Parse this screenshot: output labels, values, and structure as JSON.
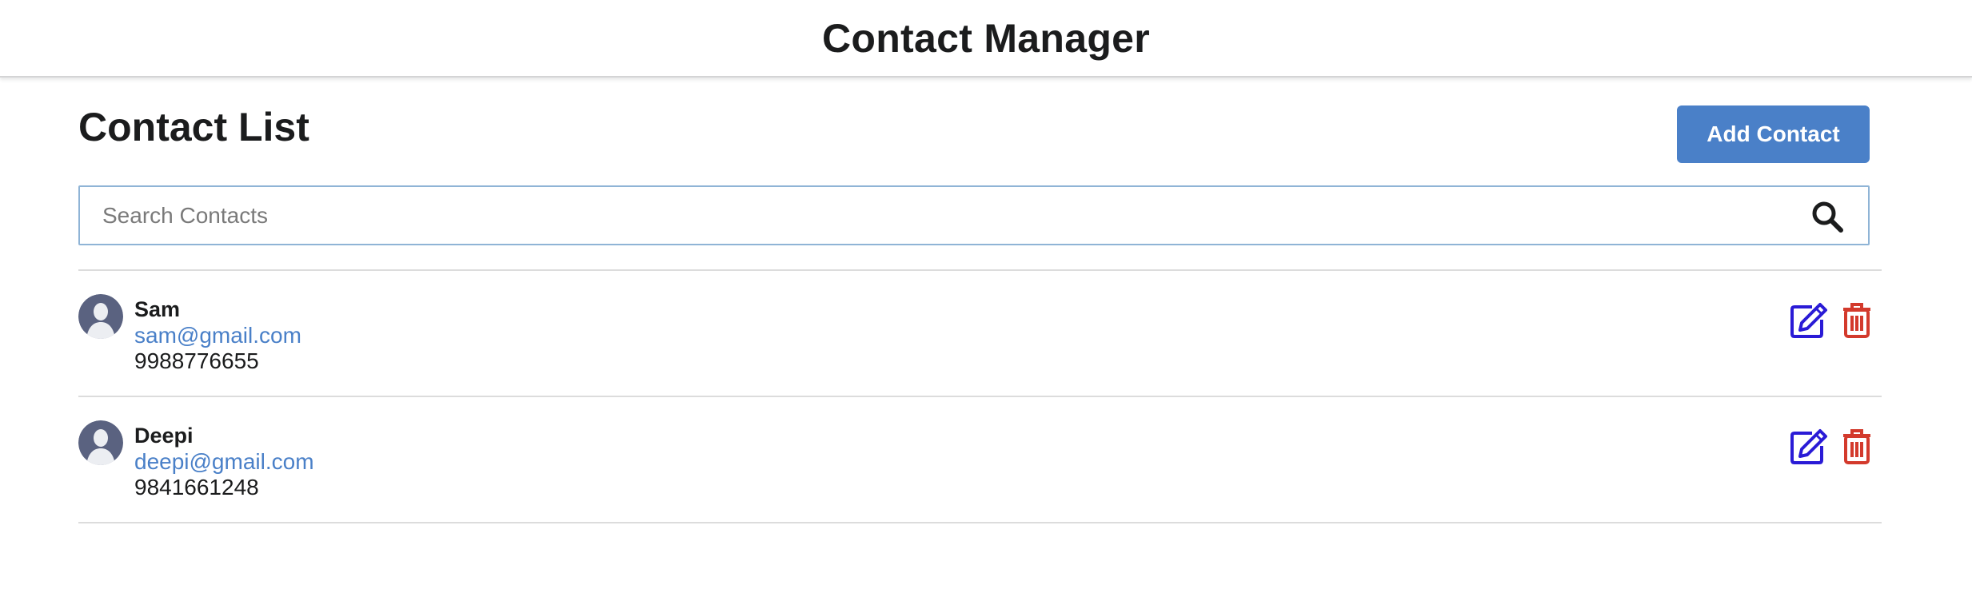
{
  "header": {
    "title": "Contact Manager"
  },
  "main": {
    "heading": "Contact List",
    "add_button_label": "Add Contact",
    "search": {
      "placeholder": "Search Contacts",
      "value": "",
      "icon": "search-icon"
    }
  },
  "contacts": [
    {
      "name": "Sam",
      "email": "sam@gmail.com",
      "phone": "9988776655"
    },
    {
      "name": "Deepi",
      "email": "deepi@gmail.com",
      "phone": "9841661248"
    }
  ],
  "colors": {
    "accent": "#4a80c8",
    "edit": "#2a1bd6",
    "delete": "#d33a2c",
    "avatar": "#5a6280"
  }
}
